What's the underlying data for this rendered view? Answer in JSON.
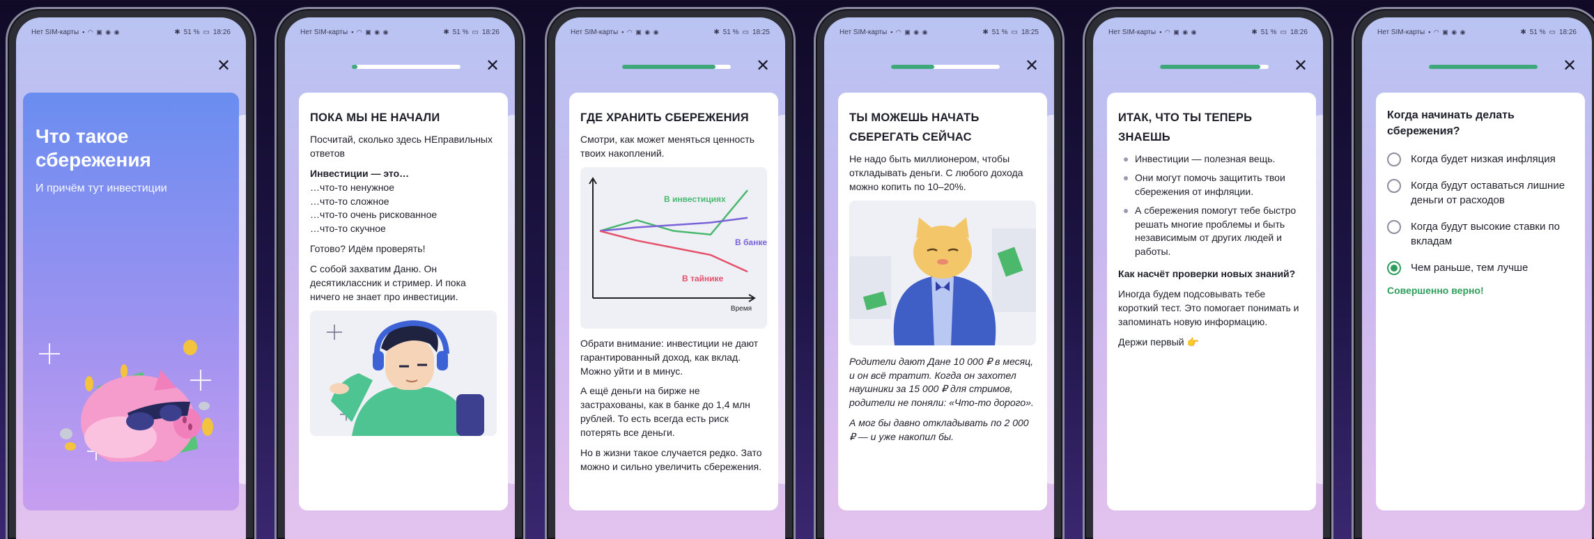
{
  "status": {
    "carrier": "Нет SIM-карты",
    "battery": "51 %",
    "times": [
      "18:26",
      "18:26",
      "18:25",
      "18:25",
      "18:26",
      "18:26"
    ]
  },
  "icons": {
    "close": "close-icon",
    "bluetooth": "bluetooth-icon",
    "wifi": "wifi-icon",
    "battery": "battery-icon",
    "point": "pointing-hand-icon"
  },
  "colors": {
    "accent_green": "#3ea87a",
    "correct_green": "#2f9e5c",
    "cover_blue": "#6a8df0",
    "cover_lilac": "#c79ef0"
  },
  "progress": [
    null,
    0.05,
    0.86,
    0.4,
    0.92,
    1.0
  ],
  "screen1": {
    "title": "Что такое сбережения",
    "subtitle": "И причём тут инвестиции"
  },
  "screen2": {
    "heading": "ПОКА МЫ НЕ НАЧАЛИ",
    "intro": "Посчитай, сколько здесь НЕправильных ответов",
    "list_title": "Инвестиции — это…",
    "items": [
      "…что-то ненужное",
      "…что-то сложное",
      "…что-то очень рискованное",
      "…что-то скучное"
    ],
    "ready": "Готово? Идём проверять!",
    "para": "С собой захватим Даню. Он десятиклассник и стример. И пока ничего не знает про инвестиции."
  },
  "screen3": {
    "heading": "ГДЕ ХРАНИТЬ СБЕРЕЖЕНИЯ",
    "intro": "Смотри, как может меняться ценность твоих накоплений.",
    "p1": "Обрати внимание: инвестиции не дают гарантированный доход, как вклад. Можно уйти и в минус.",
    "p2": "А ещё деньги на бирже не застрахованы, как в банке до 1,4 млн рублей. То есть всегда есть риск потерять все деньги.",
    "p3": "Но в жизни такое случается редко. Зато можно и сильно увеличить сбережения."
  },
  "chart_data": {
    "type": "line",
    "xlabel": "Время",
    "ylabel": "",
    "x": [
      0,
      1,
      2,
      3,
      4
    ],
    "ylim": [
      0,
      10
    ],
    "series": [
      {
        "name": "В инвестициях",
        "color": "#49b86e",
        "values": [
          5.6,
          6.5,
          5.6,
          5.3,
          9.0
        ]
      },
      {
        "name": "В банке",
        "color": "#7a63d8",
        "values": [
          5.6,
          5.9,
          6.1,
          6.3,
          6.7
        ]
      },
      {
        "name": "В тайнике",
        "color": "#e4506a",
        "values": [
          5.6,
          4.8,
          4.2,
          3.6,
          2.2
        ]
      }
    ]
  },
  "screen4": {
    "heading": "ТЫ МОЖЕШЬ НАЧАТЬ СБЕРЕГАТЬ СЕЙЧАС",
    "intro": "Не надо быть миллионером, чтобы откладывать деньги. С любого дохода можно копить по 10–20%.",
    "story": "Родители дают Дане 10 000 ₽ в месяц, и он всё тратит. Когда он захотел наушники за 15 000 ₽ для стримов, родители не поняли: «Что-то дорого».",
    "story2": "А мог бы давно откладывать по 2 000 ₽ — и уже накопил бы."
  },
  "screen5": {
    "heading": "ИТАК, ЧТО ТЫ ТЕПЕРЬ ЗНАЕШЬ",
    "bullets": [
      "Инвестиции — полезная вещь.",
      "Они могут помочь защитить твои сбережения от инфляции.",
      "А сбережения помогут тебе быстро решать многие проблемы и быть независимым от других людей и работы."
    ],
    "question": "Как насчёт проверки новых знаний?",
    "para": "Иногда будем подсовывать тебе короткий тест. Это помогает понимать и запоминать новую информацию.",
    "cta": "Держи первый 👉"
  },
  "screen6": {
    "question": "Когда начинать делать сбережения?",
    "options": [
      "Когда будет низкая инфляция",
      "Когда будут оставаться лишние деньги от расходов",
      "Когда будут высокие ставки по вкладам",
      "Чем раньше, тем лучше"
    ],
    "selected_index": 3,
    "feedback": "Совершенно верно!"
  }
}
